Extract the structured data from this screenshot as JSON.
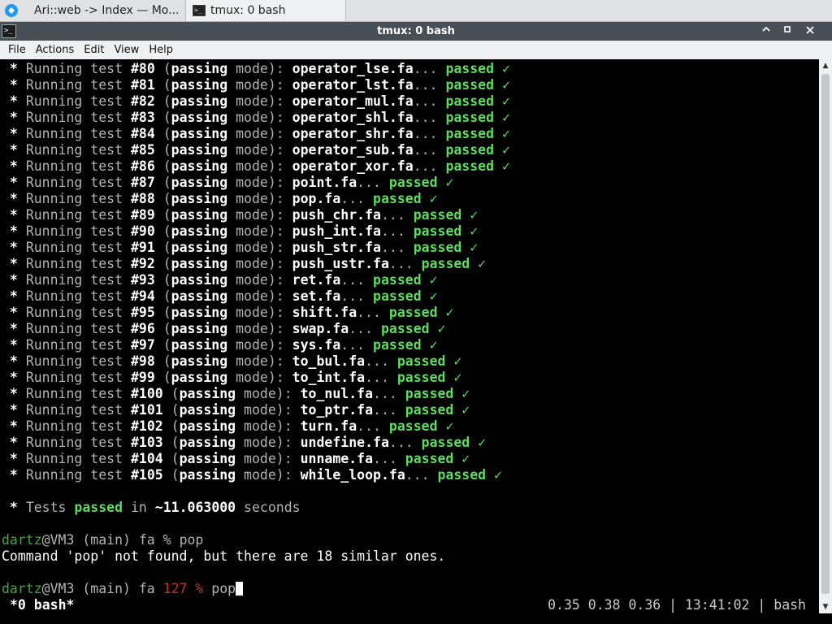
{
  "taskbar": {
    "tasks": [
      {
        "label": "Ari::web -> Index — Mo..."
      },
      {
        "label": "tmux: 0 bash"
      }
    ]
  },
  "window": {
    "title": "tmux: 0 bash",
    "terminal_icon_glyph": ">_"
  },
  "menubar": {
    "items": [
      "File",
      "Actions",
      "Edit",
      "View",
      "Help"
    ]
  },
  "terminal": {
    "tests": [
      {
        "num": "#80",
        "file": "operator_lse.fa"
      },
      {
        "num": "#81",
        "file": "operator_lst.fa"
      },
      {
        "num": "#82",
        "file": "operator_mul.fa"
      },
      {
        "num": "#83",
        "file": "operator_shl.fa"
      },
      {
        "num": "#84",
        "file": "operator_shr.fa"
      },
      {
        "num": "#85",
        "file": "operator_sub.fa"
      },
      {
        "num": "#86",
        "file": "operator_xor.fa"
      },
      {
        "num": "#87",
        "file": "point.fa"
      },
      {
        "num": "#88",
        "file": "pop.fa"
      },
      {
        "num": "#89",
        "file": "push_chr.fa"
      },
      {
        "num": "#90",
        "file": "push_int.fa"
      },
      {
        "num": "#91",
        "file": "push_str.fa"
      },
      {
        "num": "#92",
        "file": "push_ustr.fa"
      },
      {
        "num": "#93",
        "file": "ret.fa"
      },
      {
        "num": "#94",
        "file": "set.fa"
      },
      {
        "num": "#95",
        "file": "shift.fa"
      },
      {
        "num": "#96",
        "file": "swap.fa"
      },
      {
        "num": "#97",
        "file": "sys.fa"
      },
      {
        "num": "#98",
        "file": "to_bul.fa"
      },
      {
        "num": "#99",
        "file": "to_int.fa"
      },
      {
        "num": "#100",
        "file": "to_nul.fa"
      },
      {
        "num": "#101",
        "file": "to_ptr.fa"
      },
      {
        "num": "#102",
        "file": "turn.fa"
      },
      {
        "num": "#103",
        "file": "undefine.fa"
      },
      {
        "num": "#104",
        "file": "unname.fa"
      },
      {
        "num": "#105",
        "file": "while_loop.fa"
      }
    ],
    "test_prefix": " * Running test ",
    "test_paren_open": " (",
    "test_passing": "passing",
    "test_mode": " mode): ",
    "test_ellipsis": "... ",
    "test_passed": "passed",
    "test_check": " ✓",
    "summary": {
      "prefix": " * Tests ",
      "passed": "passed",
      "in": " in ",
      "time": "~11.063000",
      "suffix": " seconds"
    },
    "prompt1": {
      "user": "dartz",
      "host": "@VM3 (main) fa % ",
      "command": "pop"
    },
    "error_line": "Command 'pop' not found, but there are 18 similar ones.",
    "prompt2": {
      "user": "dartz",
      "host": "@VM3 (main) fa ",
      "code": "127 %",
      "command": " pop"
    }
  },
  "status_bar": {
    "window": "*0 bash*",
    "right": "0.35 0.38 0.36 | 13:41:02 | bash"
  },
  "colors": {
    "background": "#000000",
    "passed_green": "#5fdb5f",
    "user_green": "#3fa83f",
    "error_red": "#c03030",
    "titlebar": "#475057"
  }
}
